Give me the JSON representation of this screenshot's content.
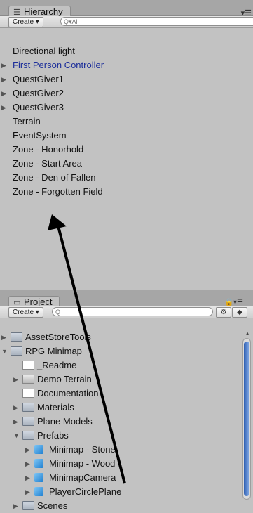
{
  "hierarchy": {
    "tab_label": "Hierarchy",
    "create_label": "Create",
    "search_placeholder": "Q▾All",
    "items": [
      {
        "label": "Directional light",
        "expandable": false,
        "selected": false
      },
      {
        "label": "First Person Controller",
        "expandable": true,
        "selected": true
      },
      {
        "label": "QuestGiver1",
        "expandable": true,
        "selected": false
      },
      {
        "label": "QuestGiver2",
        "expandable": true,
        "selected": false
      },
      {
        "label": "QuestGiver3",
        "expandable": true,
        "selected": false
      },
      {
        "label": "Terrain",
        "expandable": false,
        "selected": false
      },
      {
        "label": "EventSystem",
        "expandable": false,
        "selected": false
      },
      {
        "label": "Zone - Honorhold",
        "expandable": false,
        "selected": false
      },
      {
        "label": "Zone - Start Area",
        "expandable": false,
        "selected": false
      },
      {
        "label": "Zone - Den of Fallen",
        "expandable": false,
        "selected": false
      },
      {
        "label": "Zone - Forgotten Field",
        "expandable": false,
        "selected": false
      }
    ]
  },
  "project": {
    "tab_label": "Project",
    "create_label": "Create",
    "search_placeholder": "Q",
    "items": [
      {
        "label": "AssetStoreTools",
        "icon": "folder-icon",
        "depth": 0,
        "expand": "collapsed"
      },
      {
        "label": "RPG Minimap",
        "icon": "folder-icon",
        "depth": 0,
        "expand": "expanded"
      },
      {
        "label": "_Readme",
        "icon": "text-file-icon",
        "depth": 1,
        "expand": "none"
      },
      {
        "label": "Demo Terrain",
        "icon": "terrain-icon",
        "depth": 1,
        "expand": "collapsed"
      },
      {
        "label": "Documentation",
        "icon": "document-icon",
        "depth": 1,
        "expand": "none"
      },
      {
        "label": "Materials",
        "icon": "folder-icon",
        "depth": 1,
        "expand": "collapsed"
      },
      {
        "label": "Plane Models",
        "icon": "folder-icon",
        "depth": 1,
        "expand": "collapsed"
      },
      {
        "label": "Prefabs",
        "icon": "folder-icon",
        "depth": 1,
        "expand": "expanded"
      },
      {
        "label": "Minimap - Stone",
        "icon": "prefab-cube-icon",
        "depth": 2,
        "expand": "collapsed"
      },
      {
        "label": "Minimap - Wood",
        "icon": "prefab-cube-icon",
        "depth": 2,
        "expand": "collapsed"
      },
      {
        "label": "MinimapCamera",
        "icon": "prefab-cube-icon",
        "depth": 2,
        "expand": "collapsed"
      },
      {
        "label": "PlayerCirclePlane",
        "icon": "prefab-cube-icon",
        "depth": 2,
        "expand": "collapsed"
      },
      {
        "label": "Scenes",
        "icon": "folder-icon",
        "depth": 1,
        "expand": "collapsed"
      }
    ]
  },
  "colors": {
    "panel_bg": "#c2c2c2",
    "selected_text": "#1c2e9a",
    "annotation_arrow": "#000000"
  }
}
